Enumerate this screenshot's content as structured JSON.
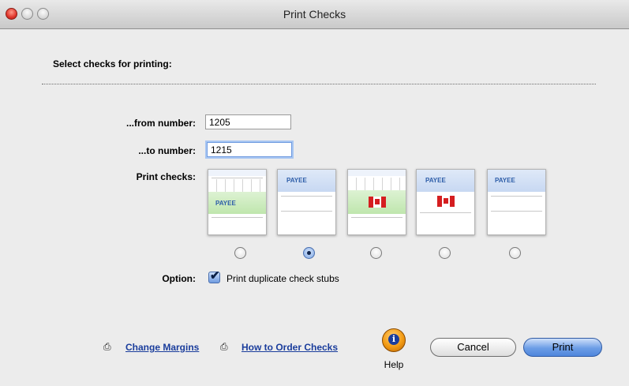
{
  "window": {
    "title": "Print Checks"
  },
  "form": {
    "heading": "Select checks for printing:",
    "from_label": "...from number:",
    "from_value": "1205",
    "to_label": "...to number:",
    "to_value": "1215",
    "print_checks_label": "Print checks:",
    "check_styles": [
      {
        "payee": "PAYEE",
        "selected": false
      },
      {
        "payee": "PAYEE",
        "selected": true
      },
      {
        "payee": "",
        "selected": false
      },
      {
        "payee": "PAYEE",
        "selected": false
      },
      {
        "payee": "PAYEE",
        "selected": false
      }
    ],
    "option_label": "Option:",
    "option_checkbox": {
      "label": "Print duplicate check stubs",
      "checked": true
    }
  },
  "footer": {
    "change_margins": "Change Margins",
    "how_to_order": "How to Order Checks",
    "help_label": "Help",
    "cancel_label": "Cancel",
    "print_label": "Print"
  },
  "colors": {
    "accent": "#6c9de6",
    "link": "#1a3d9c",
    "help": "#f29a12",
    "flag_red": "#d51e20"
  }
}
